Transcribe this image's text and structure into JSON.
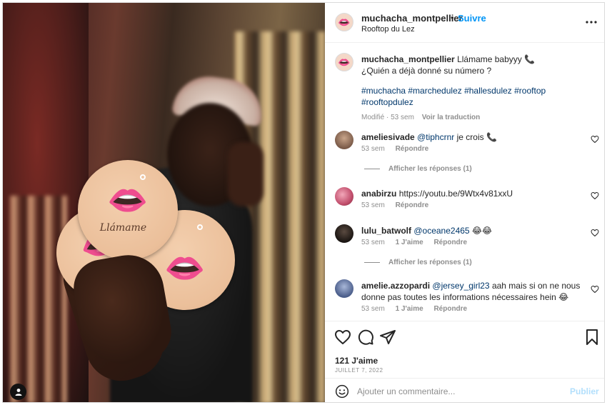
{
  "post": {
    "author": "muchacha_montpellier",
    "follow_label": "Suivre",
    "separator": "•",
    "location": "Rooftop du Lez",
    "more_icon": "more-horizontal-icon"
  },
  "caption": {
    "author": "muchacha_montpellier",
    "line1": "Llámame babyyy 📞",
    "line2": "¿Quién a déjà donné su número ?",
    "hashtags": "#muchacha #marchedulez #hallesdulez #rooftop #rooftopdulez",
    "edited": "Modifié · 53 sem",
    "translate": "Voir la traduction"
  },
  "comments": [
    {
      "user": "ameliesivade",
      "mention": "@tiphcrnr",
      "text": " je crois 📞",
      "time": "53 sem",
      "likes": "",
      "reply": "Répondre",
      "replies": "Afficher les réponses (1)"
    },
    {
      "user": "anabirzu",
      "mention": "",
      "text": "https://youtu.be/9Wtx4v81xxU",
      "time": "53 sem",
      "likes": "",
      "reply": "Répondre",
      "replies": ""
    },
    {
      "user": "lulu_batwolf",
      "mention": "@oceane2465",
      "text": " 😂😂",
      "time": "53 sem",
      "likes": "1 J'aime",
      "reply": "Répondre",
      "replies": "Afficher les réponses (1)"
    },
    {
      "user": "amelie.azzopardi",
      "mention": "@jersey_girl23",
      "text": " aah mais si on ne nous donne pas toutes les informations nécessaires hein 😂",
      "time": "53 sem",
      "likes": "1 J'aime",
      "reply": "Répondre",
      "replies": ""
    }
  ],
  "actions": {
    "likes": "121 J'aime",
    "date": "JUILLET 7, 2022"
  },
  "add_comment": {
    "placeholder": "Ajouter un commentaire...",
    "publish": "Publier"
  },
  "photo": {
    "coaster_text": "Llámame"
  },
  "colors": {
    "link_blue": "#0095f6",
    "hashtag": "#00376b",
    "muted": "#8e8e8e",
    "publish_disabled": "#b2dffc"
  }
}
